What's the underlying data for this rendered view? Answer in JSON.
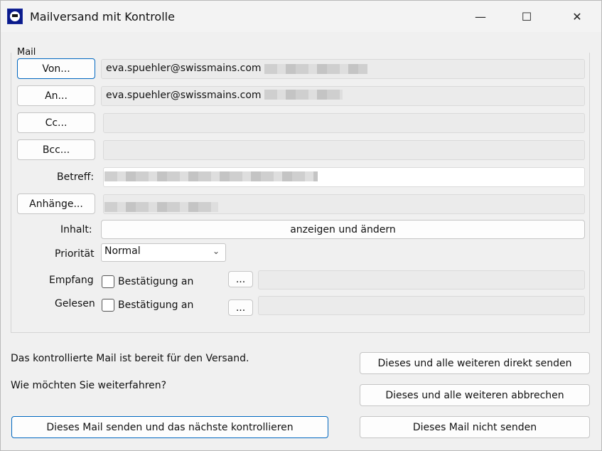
{
  "window": {
    "title": "Mailversand mit Kontrolle",
    "minimize": "—",
    "maximize": "☐",
    "close": "✕"
  },
  "mail": {
    "group_label": "Mail",
    "von_button": "Von...",
    "von_value": "eva.spuehler@swissmains.com",
    "an_button": "An...",
    "an_value": "eva.spuehler@swissmains.com",
    "cc_button": "Cc...",
    "bcc_button": "Bcc...",
    "betreff_label": "Betreff:",
    "anhaenge_button": "Anhänge...",
    "inhalt_label": "Inhalt:",
    "inhalt_button": "anzeigen und ändern",
    "prioritaet_label": "Priorität",
    "prioritaet_value": "Normal",
    "empfang_label": "Empfang",
    "gelesen_label": "Gelesen",
    "bestaetigung_label": "Bestätigung an",
    "ellipsis_button": "..."
  },
  "footer": {
    "status_line1": "Das kontrollierte Mail ist bereit für den Versand.",
    "status_line2": "Wie möchten Sie weiterfahren?",
    "send_next_button": "Dieses Mail senden und das nächste kontrollieren",
    "send_all_button": "Dieses und alle weiteren direkt senden",
    "cancel_all_button": "Dieses und alle weiteren abbrechen",
    "dont_send_button": "Dieses Mail nicht senden"
  }
}
